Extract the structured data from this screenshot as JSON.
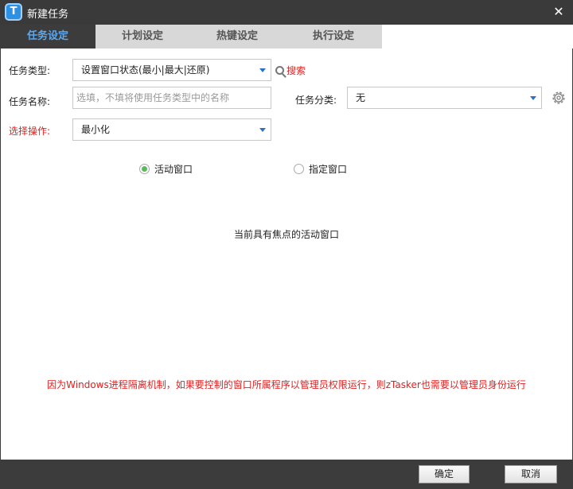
{
  "window": {
    "title": "新建任务",
    "close_symbol": "✕"
  },
  "tabs": [
    {
      "label": "任务设定",
      "active": true
    },
    {
      "label": "计划设定",
      "active": false
    },
    {
      "label": "热键设定",
      "active": false
    },
    {
      "label": "执行设定",
      "active": false
    }
  ],
  "form": {
    "task_type_label": "任务类型:",
    "task_type_value": "设置窗口状态(最小|最大|还原)",
    "search_label": "搜索",
    "task_name_label": "任务名称:",
    "task_name_value": "",
    "task_name_placeholder": "选填，不填将使用任务类型中的名称",
    "category_label": "任务分类:",
    "category_value": "无",
    "operation_label": "选择操作:",
    "operation_value": "最小化"
  },
  "window_target": {
    "option_active": "活动窗口",
    "option_specified": "指定窗口",
    "selected": "活动窗口",
    "description": "当前具有焦点的活动窗口"
  },
  "warning": "因为Windows进程隔离机制，如果要控制的窗口所属程序以管理员权限运行，则zTasker也需要以管理员身份运行",
  "footer": {
    "ok_label": "确定",
    "cancel_label": "取消"
  },
  "colors": {
    "titlebar": "#3a3a3a",
    "active_tab_text": "#5aa8f0",
    "warning_text": "#e02020",
    "dropdown_arrow": "#2a6fc9",
    "radio_checked": "#5cb85c"
  },
  "icons": {
    "app": "ztasker-logo-icon",
    "close": "close-icon",
    "search": "search-icon",
    "settings": "gear-icon",
    "dropdown": "chevron-down-icon"
  }
}
